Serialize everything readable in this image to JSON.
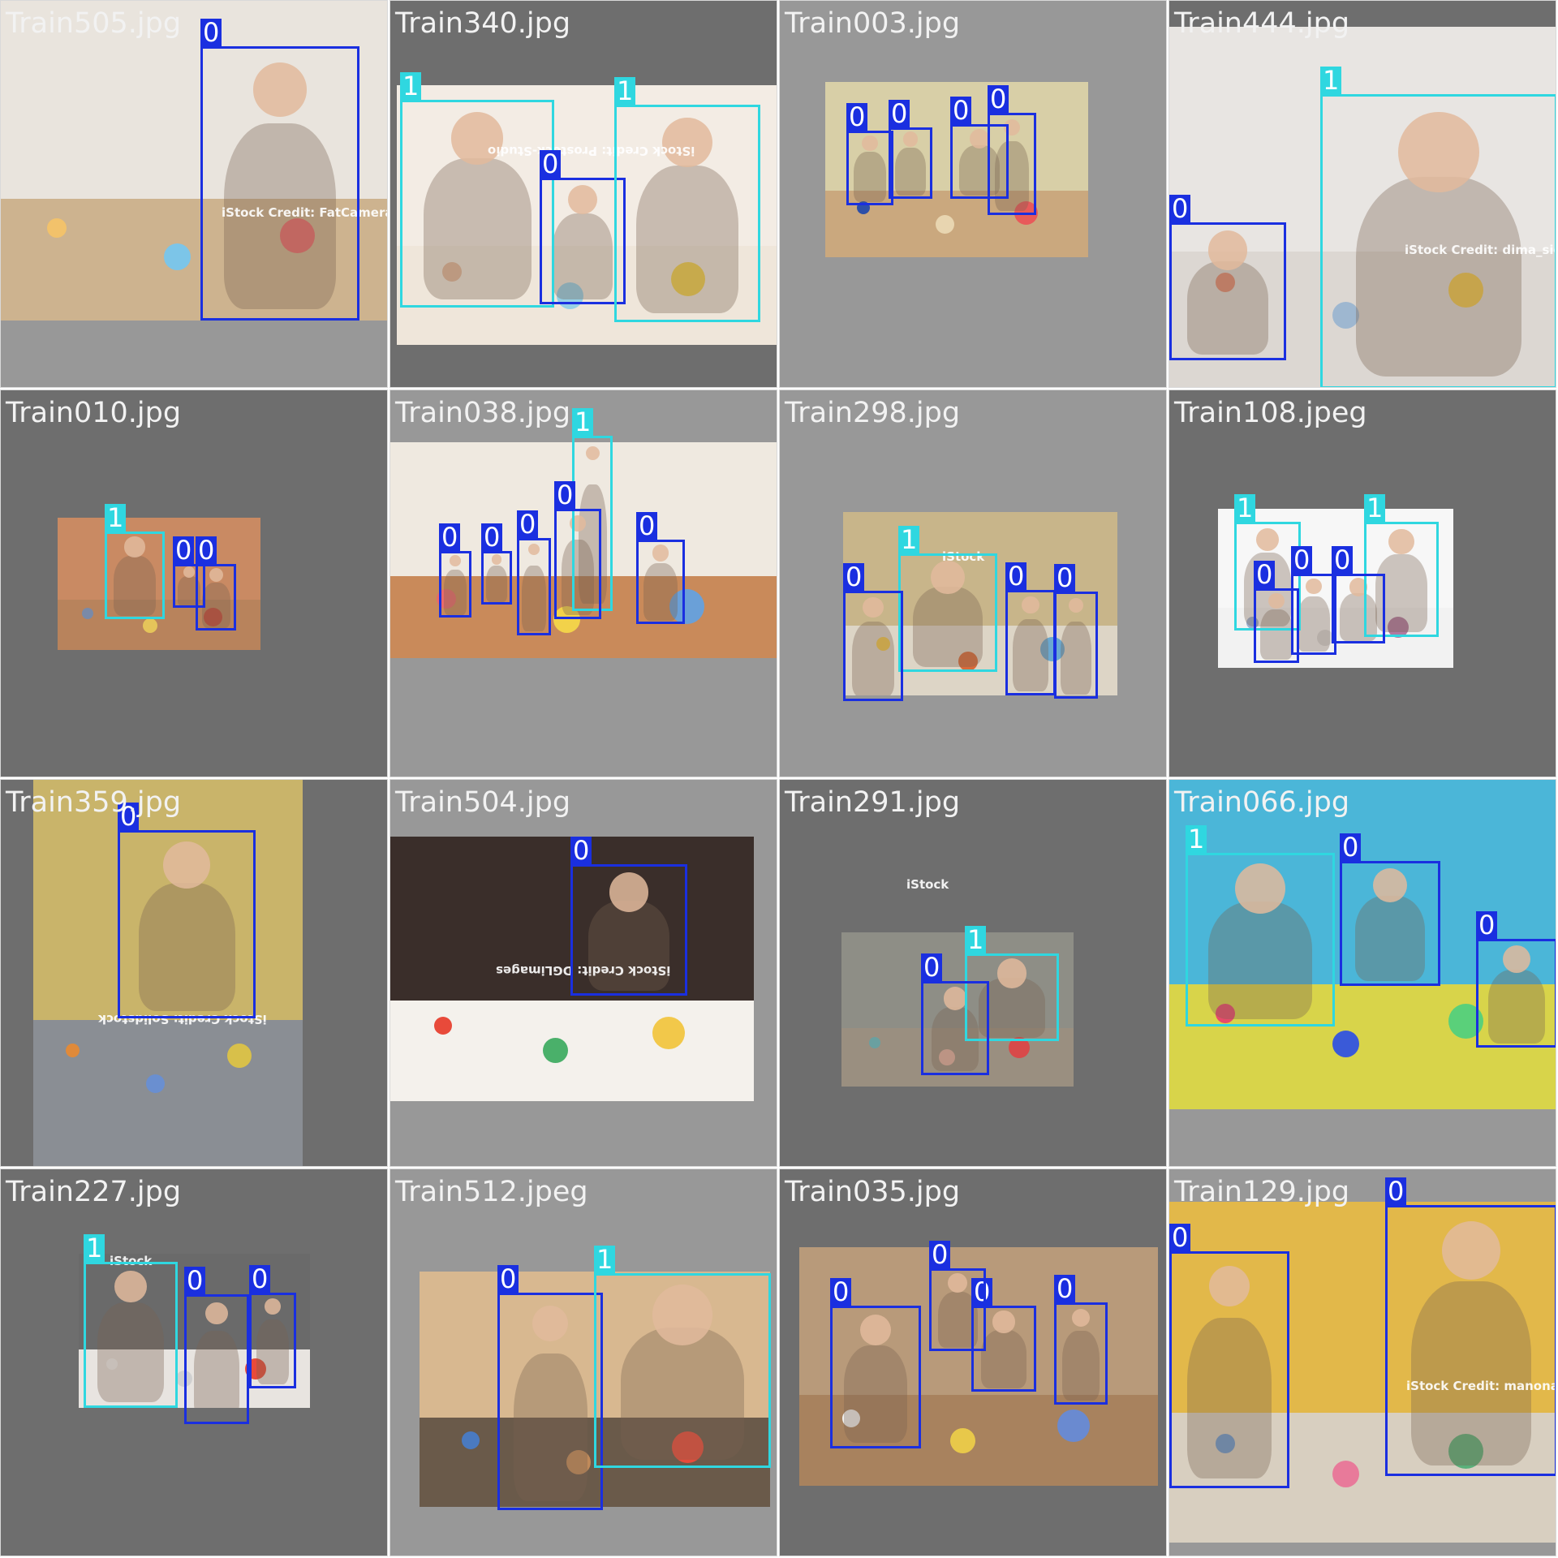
{
  "grid_title": "",
  "colors": {
    "class_0": "#1a2fe0",
    "class_1": "#2fd7e0",
    "tile_dark": "#6e6e6e",
    "tile_light": "#989898",
    "label_text": "#f2f2f2"
  },
  "tiles": [
    {
      "filename": "Train505.jpg",
      "watermark": "iStock Credit: FatCamera",
      "boxes": [
        {
          "label": "0"
        }
      ]
    },
    {
      "filename": "Train340.jpg",
      "watermark": "iStock Credit: Prostock-Studio",
      "boxes": [
        {
          "label": "1"
        },
        {
          "label": "0"
        },
        {
          "label": "1"
        }
      ]
    },
    {
      "filename": "Train003.jpg",
      "watermark": "",
      "boxes": [
        {
          "label": "0"
        },
        {
          "label": "0"
        },
        {
          "label": "0"
        },
        {
          "label": "0"
        }
      ]
    },
    {
      "filename": "Train444.jpg",
      "watermark": "iStock Credit: dima_sidelnikov",
      "boxes": [
        {
          "label": "1"
        },
        {
          "label": "0"
        }
      ]
    },
    {
      "filename": "Train010.jpg",
      "watermark": "",
      "boxes": [
        {
          "label": "1"
        },
        {
          "label": "0"
        },
        {
          "label": "0"
        }
      ]
    },
    {
      "filename": "Train038.jpg",
      "watermark": "",
      "boxes": [
        {
          "label": "1"
        },
        {
          "label": "0"
        },
        {
          "label": "0"
        },
        {
          "label": "0"
        },
        {
          "label": "0"
        },
        {
          "label": "0"
        }
      ]
    },
    {
      "filename": "Train298.jpg",
      "watermark": "iStock",
      "boxes": [
        {
          "label": "1"
        },
        {
          "label": "0"
        },
        {
          "label": "0"
        },
        {
          "label": "0"
        }
      ]
    },
    {
      "filename": "Train108.jpeg",
      "watermark": "",
      "boxes": [
        {
          "label": "1"
        },
        {
          "label": "1"
        },
        {
          "label": "0"
        },
        {
          "label": "0"
        },
        {
          "label": "0"
        }
      ]
    },
    {
      "filename": "Train359.jpg",
      "watermark": "iStock Credit: Solidstock",
      "boxes": [
        {
          "label": "0"
        }
      ]
    },
    {
      "filename": "Train504.jpg",
      "watermark": "iStock Credit: DGLimages",
      "boxes": [
        {
          "label": "0"
        }
      ]
    },
    {
      "filename": "Train291.jpg",
      "watermark": "iStock",
      "boxes": [
        {
          "label": "1"
        },
        {
          "label": "0"
        }
      ]
    },
    {
      "filename": "Train066.jpg",
      "watermark": "",
      "boxes": [
        {
          "label": "1"
        },
        {
          "label": "0"
        },
        {
          "label": "0"
        }
      ]
    },
    {
      "filename": "Train227.jpg",
      "watermark": "iStock",
      "boxes": [
        {
          "label": "1"
        },
        {
          "label": "0"
        },
        {
          "label": "0"
        }
      ]
    },
    {
      "filename": "Train512.jpeg",
      "watermark": "",
      "boxes": [
        {
          "label": "0"
        },
        {
          "label": "1"
        }
      ]
    },
    {
      "filename": "Train035.jpg",
      "watermark": "",
      "boxes": [
        {
          "label": "0"
        },
        {
          "label": "0"
        },
        {
          "label": "0"
        },
        {
          "label": "0"
        }
      ]
    },
    {
      "filename": "Train129.jpg",
      "watermark": "iStock Credit: manonallard",
      "boxes": [
        {
          "label": "0"
        },
        {
          "label": "0"
        }
      ]
    }
  ]
}
